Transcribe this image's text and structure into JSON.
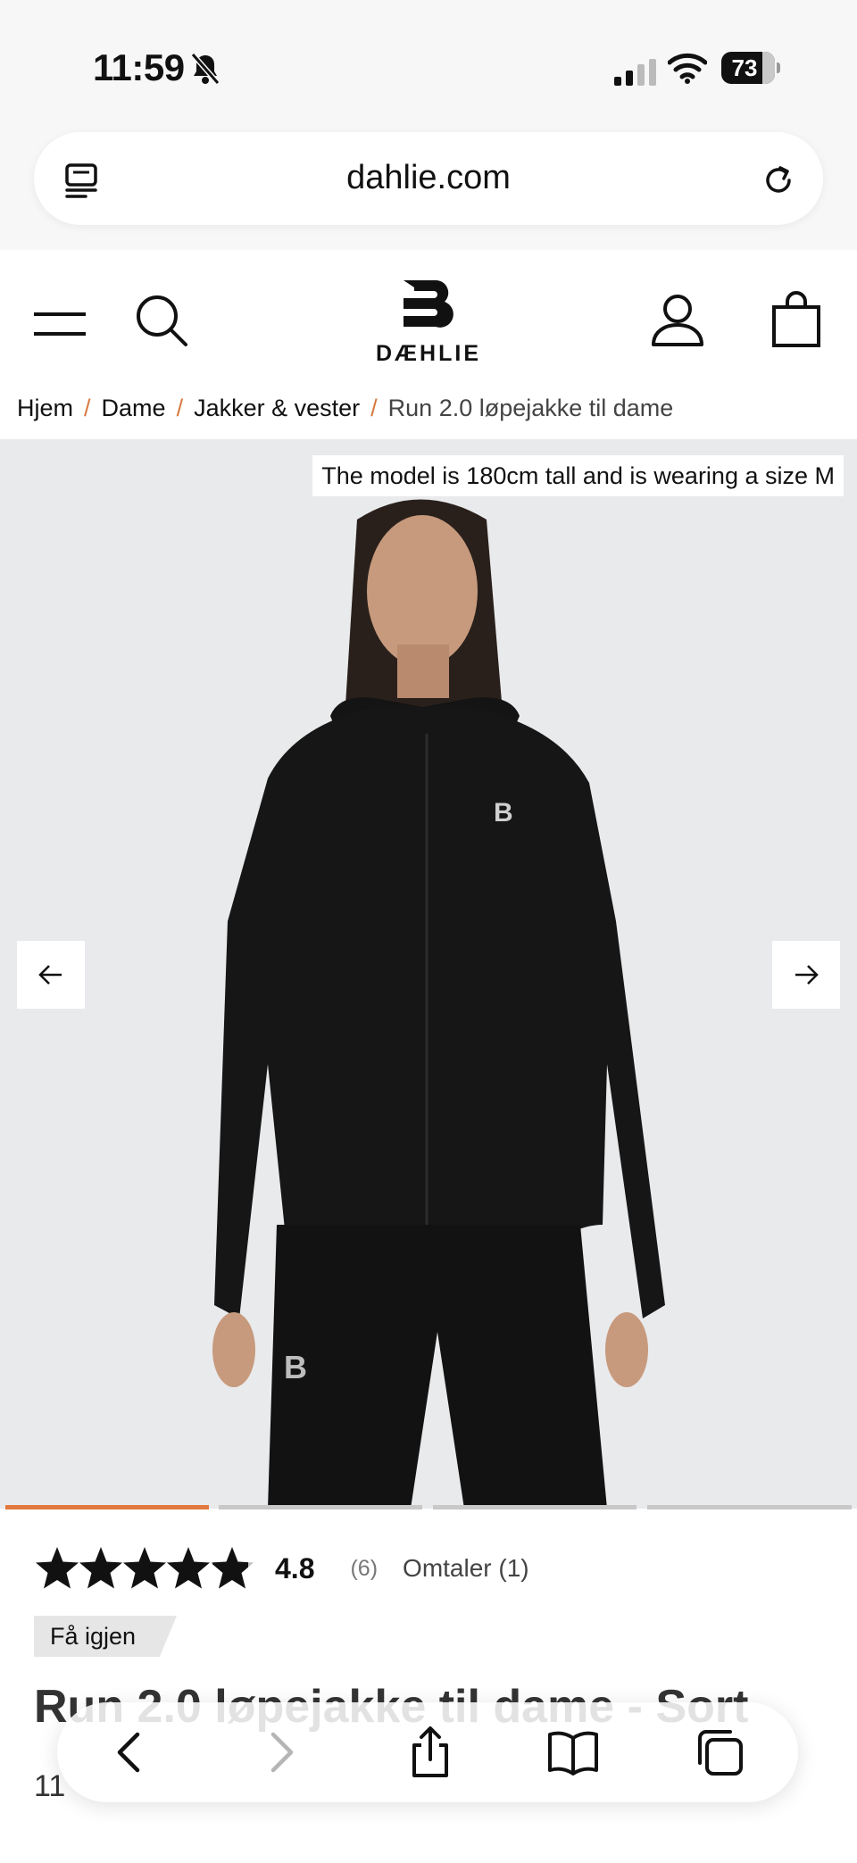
{
  "status_bar": {
    "time": "11:59",
    "battery": "73"
  },
  "browser": {
    "url": "dahlie.com"
  },
  "header": {
    "logo_text": "DÆHLIE"
  },
  "breadcrumb": {
    "items": [
      "Hjem",
      "Dame",
      "Jakker & vester",
      "Run 2.0 løpejakke til dame"
    ],
    "separator": "/"
  },
  "gallery": {
    "model_caption": "The model is 180cm tall and is wearing a size M",
    "image_count": 4,
    "active_index": 0
  },
  "product": {
    "rating": "4.8",
    "rating_count": "(6)",
    "reviews_link": "Omtaler (1)",
    "badge": "Få igjen",
    "title": "Run 2.0 løpejakke til dame - Sort",
    "price_partial": "11"
  },
  "colors": {
    "accent": "#e4793f",
    "gallery_bg": "#e9eaec"
  }
}
